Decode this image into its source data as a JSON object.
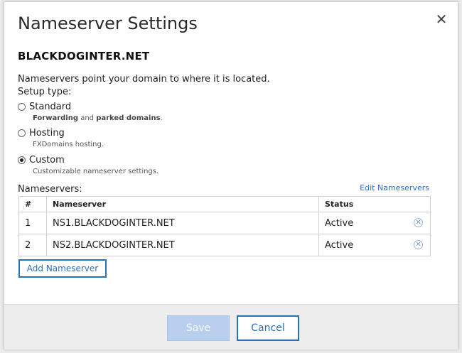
{
  "dialog": {
    "title": "Nameserver Settings",
    "close_glyph": "✕",
    "domain": "BLACKDOGINTER.NET",
    "intro": "Nameservers point your domain to where it is located.",
    "setup_label": "Setup type:",
    "options": [
      {
        "label": "Standard",
        "desc_part1": "Forwarding",
        "desc_part2": " and ",
        "desc_part3": "parked domains",
        "desc_part4": ".",
        "checked": false
      },
      {
        "label": "Hosting",
        "desc": "FXDomains hosting.",
        "checked": false
      },
      {
        "label": "Custom",
        "desc": "Customizable nameserver settings.",
        "checked": true
      }
    ],
    "nameservers_label": "Nameservers:",
    "edit_link": "Edit Nameservers",
    "table": {
      "headers": [
        "#",
        "Nameserver",
        "Status"
      ],
      "rows": [
        {
          "num": "1",
          "name": "NS1.BLACKDOGINTER.NET",
          "status": "Active"
        },
        {
          "num": "2",
          "name": "NS2.BLACKDOGINTER.NET",
          "status": "Active"
        }
      ]
    },
    "add_button": "Add Nameserver",
    "save_button": "Save",
    "cancel_button": "Cancel"
  },
  "colors": {
    "accent": "#2c6fb7",
    "link": "#2a6fc9",
    "save_disabled": "#b8d0ee"
  },
  "icons": {
    "close": "close-icon",
    "remove": "remove-circle-icon",
    "radio": "radio-button"
  }
}
